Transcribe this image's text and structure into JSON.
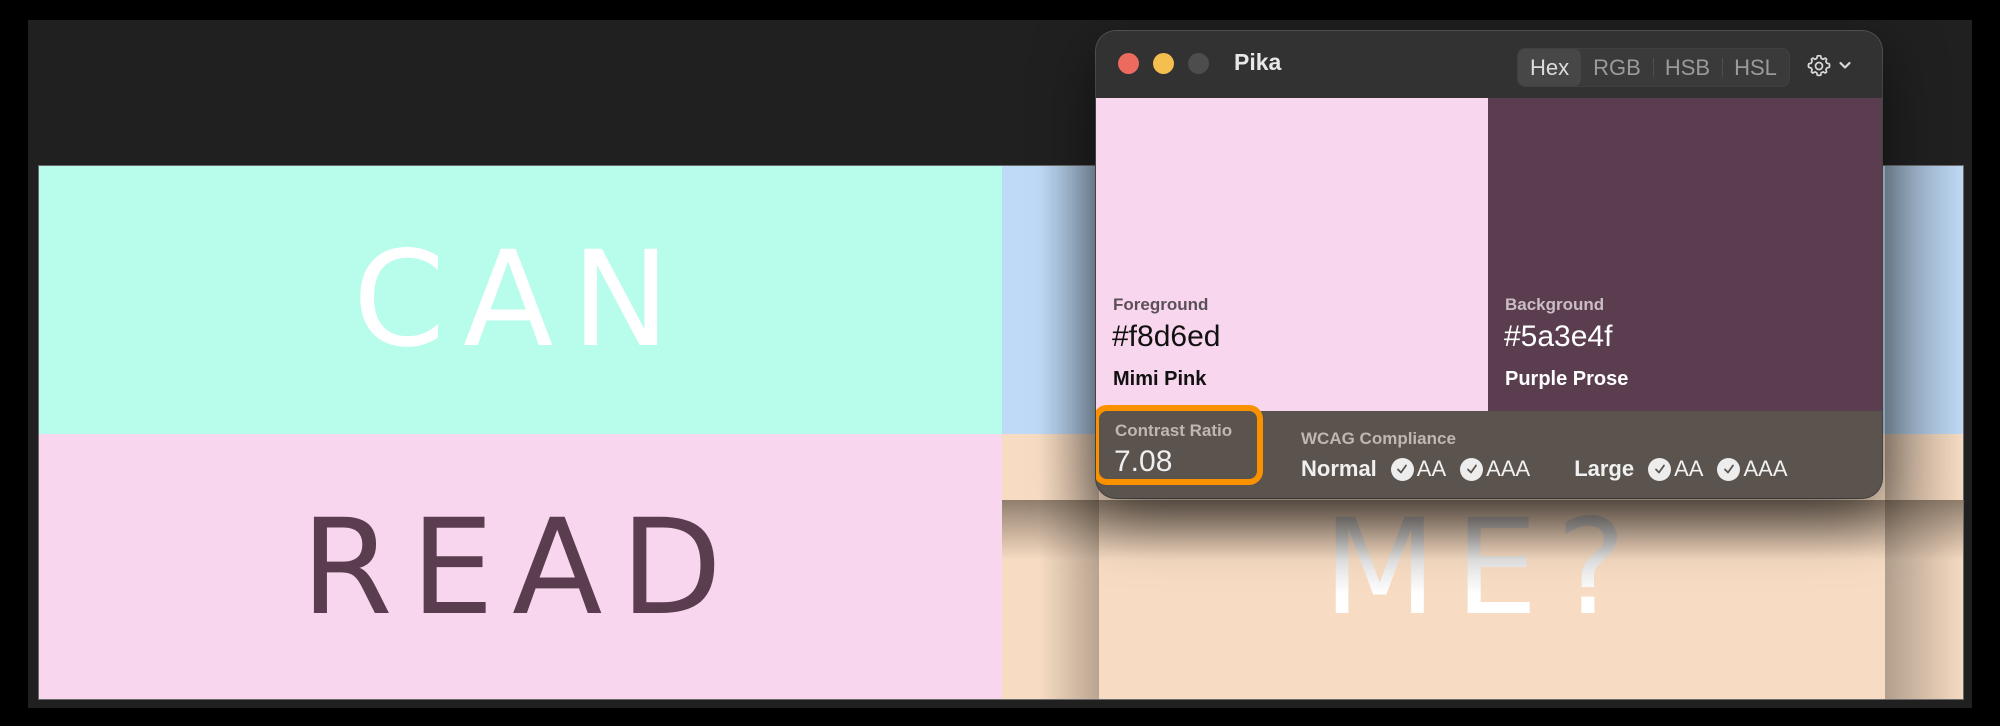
{
  "canvas": {
    "words": [
      {
        "text": "CAN",
        "text_color": "#ffffff",
        "bg_color": "#b8fcec"
      },
      {
        "text": "",
        "text_color": "",
        "bg_color": "#bfdaf6"
      },
      {
        "text": "READ",
        "text_color": "#5a3e4f",
        "bg_color": "#f8d6ed"
      },
      {
        "text": "ME?",
        "text_color": "#ffffff",
        "bg_color": "#f7dcc3"
      }
    ]
  },
  "window": {
    "title": "Pika",
    "traffic_lights": [
      "close",
      "minimize",
      "zoom"
    ],
    "format_tabs": [
      {
        "label": "Hex",
        "active": true
      },
      {
        "label": "RGB",
        "active": false
      },
      {
        "label": "HSB",
        "active": false
      },
      {
        "label": "HSL",
        "active": false
      }
    ],
    "settings_icon": "gear-icon",
    "settings_menu_icon": "chevron-down-icon"
  },
  "foreground": {
    "label": "Foreground",
    "hex": "#f8d6ed",
    "name": "Mimi Pink"
  },
  "background": {
    "label": "Background",
    "hex": "#5a3e4f",
    "name": "Purple Prose"
  },
  "contrast": {
    "label": "Contrast Ratio",
    "value": "7.08",
    "highlight_color": "#fa9200"
  },
  "wcag": {
    "label": "WCAG Compliance",
    "normal": {
      "label": "Normal",
      "levels": [
        "AA",
        "AAA"
      ]
    },
    "large": {
      "label": "Large",
      "levels": [
        "AA",
        "AAA"
      ]
    }
  }
}
